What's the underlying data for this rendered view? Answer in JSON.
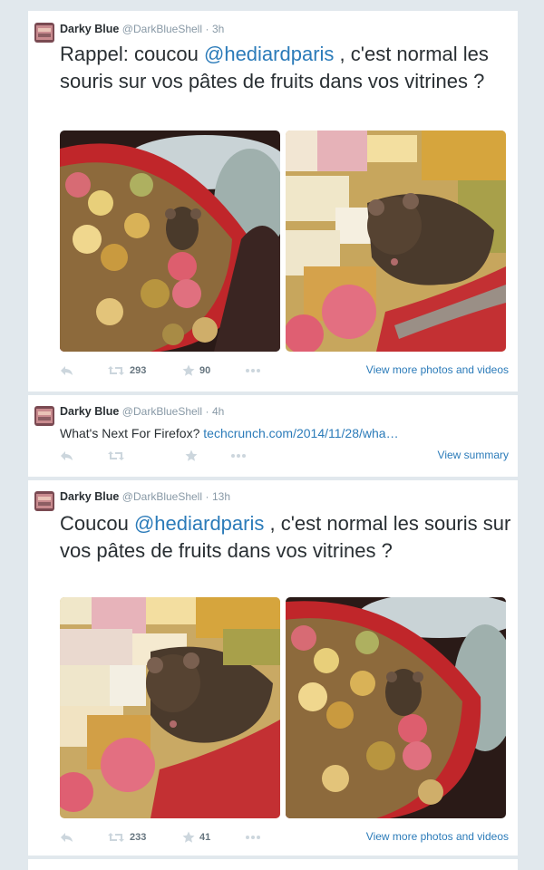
{
  "tweets": [
    {
      "author": {
        "name": "Darky Blue",
        "handle": "@DarkBlueShell",
        "dot": "·",
        "time": "3h"
      },
      "text": {
        "pre": "Rappel: coucou ",
        "mention": "@hediardparis",
        "post": " , c'est normal les souris sur vos pâtes de fruits dans vos vitrines ?"
      },
      "actions": {
        "retweets": "293",
        "favorites": "90",
        "link": "View more photos and videos"
      }
    },
    {
      "author": {
        "name": "Darky Blue",
        "handle": "@DarkBlueShell",
        "dot": "·",
        "time": "4h"
      },
      "text": {
        "pre": "What's Next For Firefox? ",
        "link": "techcrunch.com/2014/11/28/wha…"
      },
      "actions": {
        "link": "View summary"
      }
    },
    {
      "author": {
        "name": "Darky Blue",
        "handle": "@DarkBlueShell",
        "dot": "·",
        "time": "13h"
      },
      "text": {
        "pre": "Coucou ",
        "mention": "@hediardparis",
        "post": " , c'est normal les souris sur vos pâtes de fruits dans vos vitrines ?"
      },
      "actions": {
        "retweets": "233",
        "favorites": "41",
        "link": "View more photos and videos"
      }
    }
  ],
  "icons": {
    "reply": "reply-icon",
    "retweet": "retweet-icon",
    "favorite": "star-icon",
    "more": "more-icon"
  },
  "colors": {
    "link": "#2b7bb9",
    "meta": "#8899a6",
    "divider": "#e1e8ed"
  }
}
